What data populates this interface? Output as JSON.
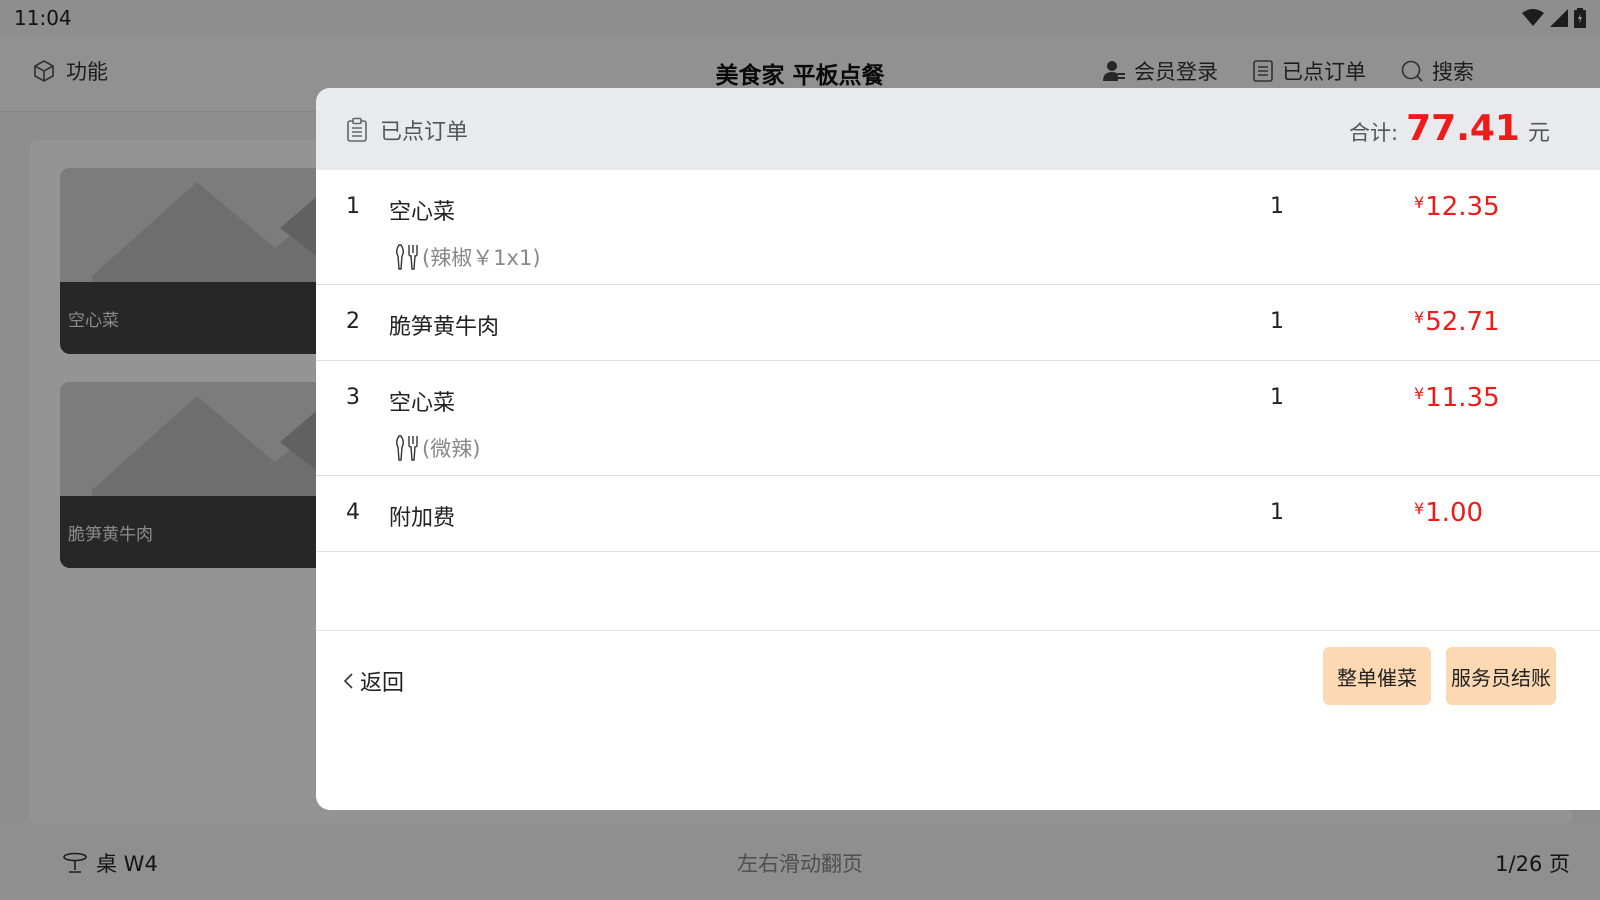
{
  "status": {
    "time": "11:04"
  },
  "header": {
    "function_label": "功能",
    "title": "美食家 平板点餐",
    "member_login": "会员登录",
    "ordered": "已点订单",
    "search": "搜索"
  },
  "menu": {
    "items": [
      {
        "name": "空心菜"
      },
      {
        "name": "脆笋黄牛肉"
      }
    ]
  },
  "footer": {
    "table": "桌 W4",
    "hint": "左右滑动翻页",
    "page": "1/26 页"
  },
  "modal": {
    "title": "已点订单",
    "total_label": "合计:",
    "total_amount": "77.41",
    "total_unit": "元",
    "currency_symbol": "¥",
    "items": [
      {
        "index": "1",
        "name": "空心菜",
        "qty": "1",
        "price": "12.35",
        "note": "(辣椒￥1x1)"
      },
      {
        "index": "2",
        "name": "脆笋黄牛肉",
        "qty": "1",
        "price": "52.71"
      },
      {
        "index": "3",
        "name": "空心菜",
        "qty": "1",
        "price": "11.35",
        "note": "(微辣)"
      },
      {
        "index": "4",
        "name": "附加费",
        "qty": "1",
        "price": "1.00"
      }
    ],
    "back_label": "返回",
    "urge_all_label": "整单催菜",
    "waiter_checkout_label": "服务员结账"
  },
  "colors": {
    "accent_red": "#ee1b1b",
    "button_bg": "#fcd9b3",
    "modal_header_bg": "#e9eaee"
  }
}
